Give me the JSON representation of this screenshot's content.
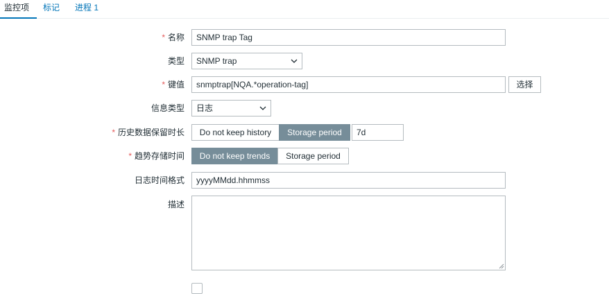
{
  "tabs": [
    {
      "label": "监控项"
    },
    {
      "label": "标记"
    },
    {
      "label": "进程 1"
    }
  ],
  "form": {
    "name": {
      "label": "名称",
      "required": true,
      "value": "SNMP trap Tag"
    },
    "type": {
      "label": "类型",
      "value": "SNMP trap"
    },
    "key": {
      "label": "键值",
      "required": true,
      "value": "snmptrap[NQA.*operation-tag]",
      "select_button": "选择"
    },
    "info_type": {
      "label": "信息类型",
      "value": "日志"
    },
    "history": {
      "label": "历史数据保留时长",
      "required": true,
      "opt_no": "Do not keep history",
      "opt_storage": "Storage period",
      "selected": "Storage period",
      "value": "7d"
    },
    "trends": {
      "label": "趋势存储时间",
      "required": true,
      "opt_no": "Do not keep trends",
      "opt_storage": "Storage period",
      "selected": "Do not keep trends"
    },
    "log_time_format": {
      "label": "日志时间格式",
      "value": "yyyyMMdd.hhmmss"
    },
    "description": {
      "label": "描述",
      "value": ""
    }
  },
  "required_mark": "*",
  "colors": {
    "accent": "#0275b8",
    "required": "#e45959",
    "segment_on": "#768d99",
    "border": "#b4bbbf"
  }
}
